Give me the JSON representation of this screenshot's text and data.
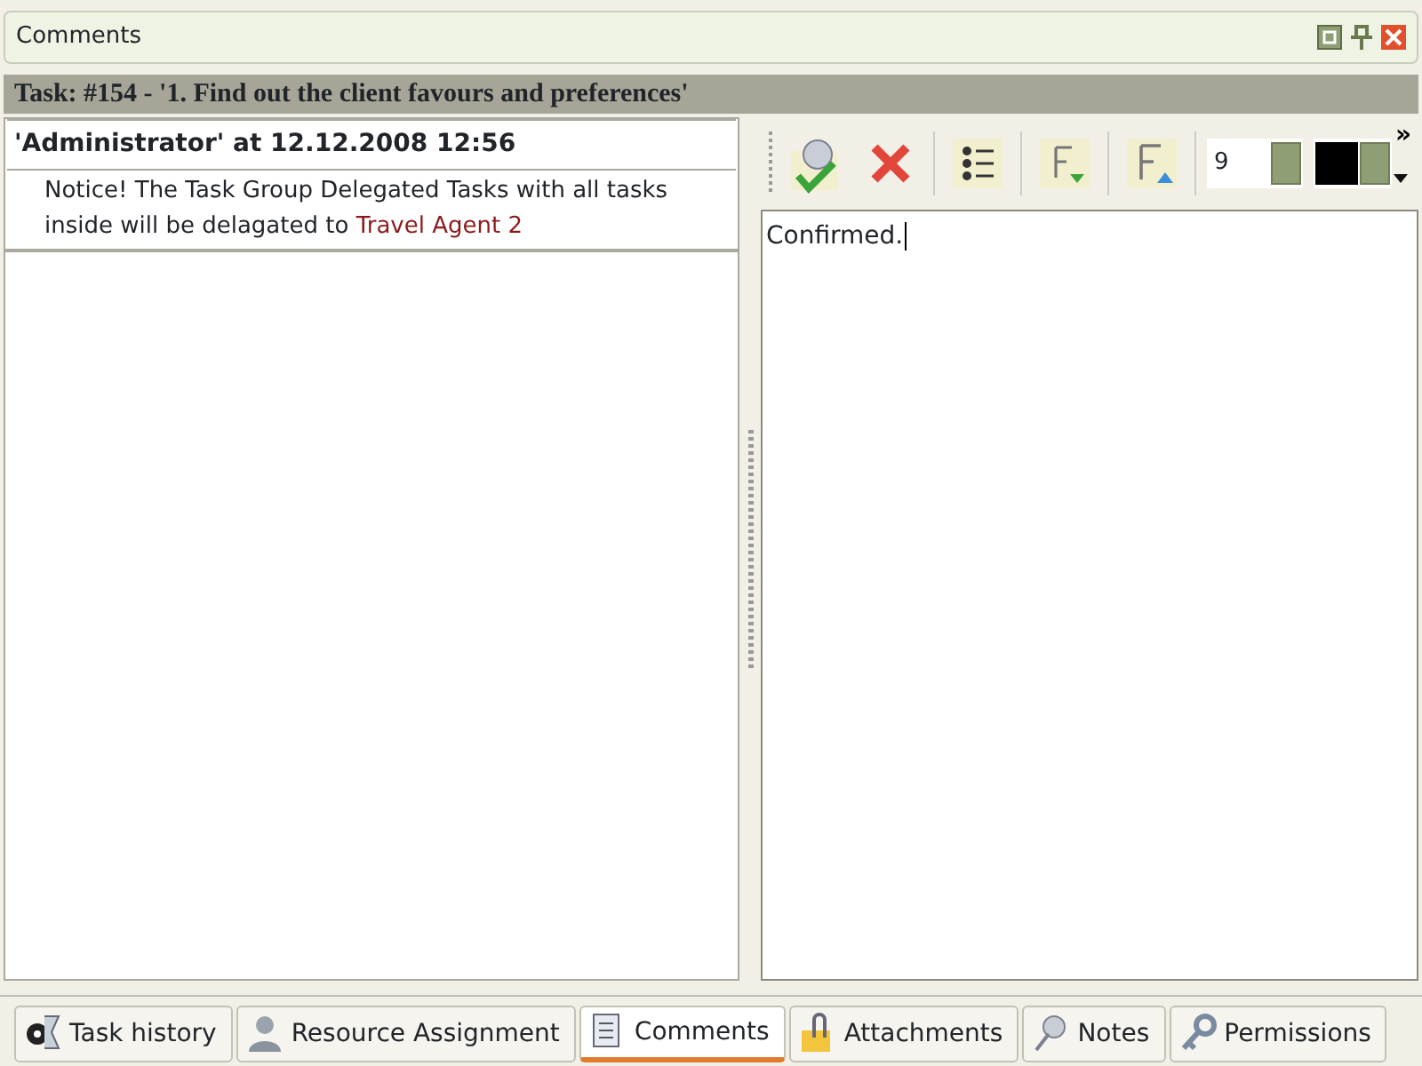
{
  "panel": {
    "title": "Comments"
  },
  "task_header": "Task: #154 - '1. Find out the client favours and preferences'",
  "comments": [
    {
      "author": "'Administrator' at 12.12.2008 12:56",
      "message": "Notice! The Task Group Delegated Tasks with all tasks inside will be delagated to ",
      "recipient": "Travel Agent 2"
    }
  ],
  "editor": {
    "font_size": "9",
    "overflow": "»",
    "text": "Confirmed."
  },
  "tabs": [
    {
      "label": "Task history",
      "selected": false
    },
    {
      "label": "Resource Assignment",
      "selected": false
    },
    {
      "label": "Comments",
      "selected": true
    },
    {
      "label": "Attachments",
      "selected": false
    },
    {
      "label": "Notes",
      "selected": false
    },
    {
      "label": "Permissions",
      "selected": false
    }
  ]
}
